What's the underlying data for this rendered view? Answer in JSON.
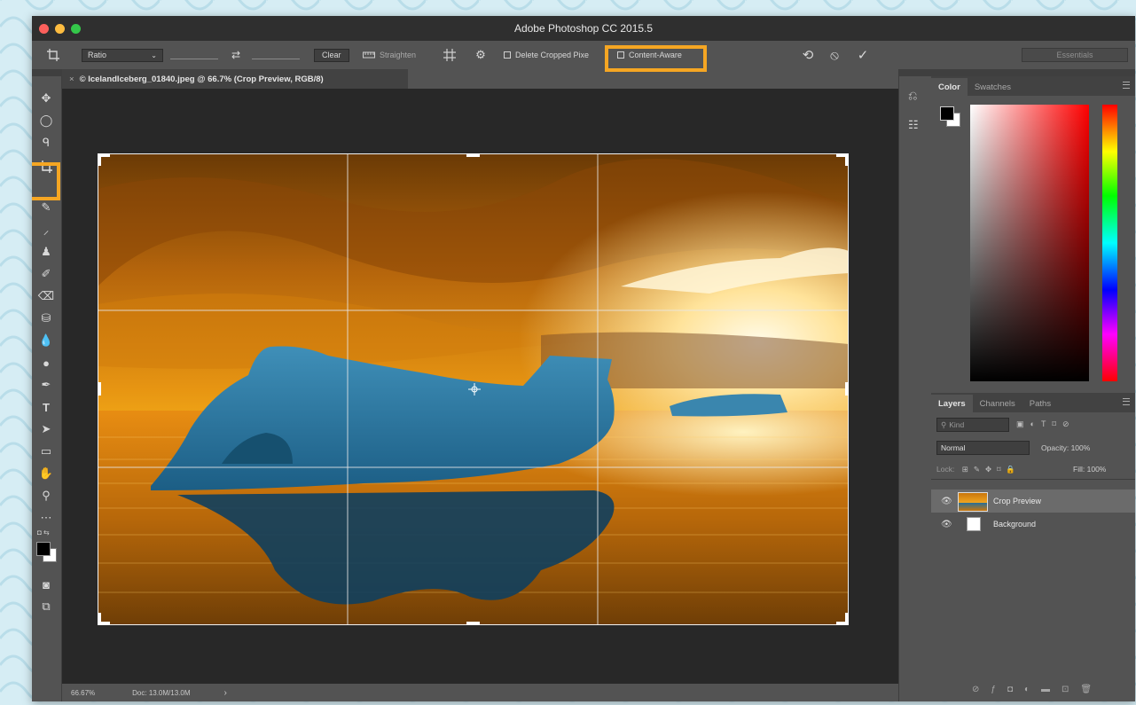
{
  "app": {
    "title": "Adobe Photoshop CC 2015.5"
  },
  "options_bar": {
    "ratio_label": "Ratio",
    "clear_label": "Clear",
    "straighten_label": "Straighten",
    "delete_cropped_label": "Delete Cropped Pixe",
    "content_aware_label": "Content-Aware",
    "workspace_label": "Essentials"
  },
  "document": {
    "tab_title": "© IcelandIceberg_01840.jpeg @ 66.7% (Crop Preview, RGB/8)",
    "zoom": "66.67%",
    "doc_info": "Doc: 13.0M/13.0M",
    "status_arrow": "›"
  },
  "panels": {
    "color_tabs": [
      "Color",
      "Swatches"
    ],
    "layers_tabs": [
      "Layers",
      "Channels",
      "Paths"
    ],
    "kind_placeholder": "Kind",
    "blend_mode": "Normal",
    "opacity_label": "Opacity:",
    "opacity_value": "100%",
    "lock_label": "Lock:",
    "fill_label": "Fill:",
    "fill_value": "100%",
    "layers": [
      {
        "name": "Crop Preview",
        "selected": true
      },
      {
        "name": "Background",
        "selected": false
      }
    ]
  },
  "colors": {
    "highlight": "#f5a623",
    "title_bar": "#2f2f2f",
    "ui_gray": "#535353",
    "canvas_bg": "#282828"
  }
}
